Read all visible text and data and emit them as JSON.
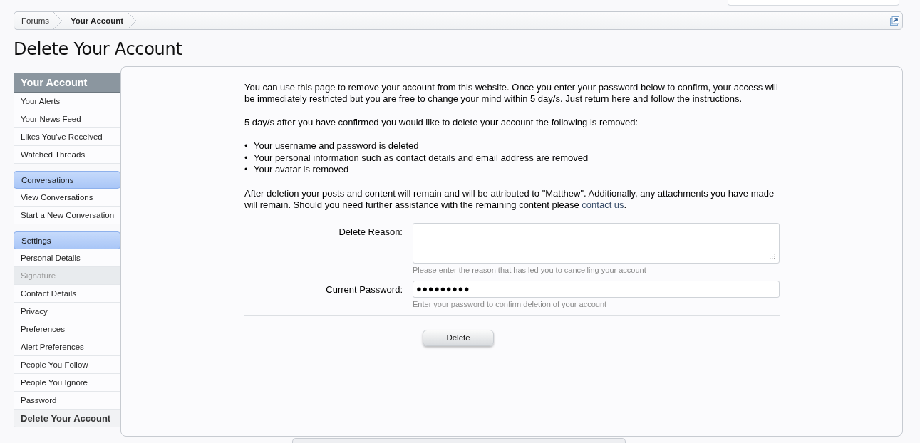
{
  "breadcrumb": [
    {
      "label": "Forums",
      "selected": false
    },
    {
      "label": "Your Account",
      "selected": true
    }
  ],
  "page_title": "Delete Your Account",
  "sidebar": [
    {
      "heading": "Your Account",
      "kind": "main",
      "items": [
        {
          "label": "Your Alerts",
          "selected": false,
          "disabled": false
        },
        {
          "label": "Your News Feed",
          "selected": false,
          "disabled": false
        },
        {
          "label": "Likes You've Received",
          "selected": false,
          "disabled": false
        },
        {
          "label": "Watched Threads",
          "selected": false,
          "disabled": false
        }
      ]
    },
    {
      "heading": "Conversations",
      "kind": "sub",
      "items": [
        {
          "label": "View Conversations",
          "selected": false,
          "disabled": false
        },
        {
          "label": "Start a New Conversation",
          "selected": false,
          "disabled": false
        }
      ]
    },
    {
      "heading": "Settings",
      "kind": "sub",
      "items": [
        {
          "label": "Personal Details",
          "selected": false,
          "disabled": false
        },
        {
          "label": "Signature",
          "selected": false,
          "disabled": true
        },
        {
          "label": "Contact Details",
          "selected": false,
          "disabled": false
        },
        {
          "label": "Privacy",
          "selected": false,
          "disabled": false
        },
        {
          "label": "Preferences",
          "selected": false,
          "disabled": false
        },
        {
          "label": "Alert Preferences",
          "selected": false,
          "disabled": false
        },
        {
          "label": "People You Follow",
          "selected": false,
          "disabled": false
        },
        {
          "label": "People You Ignore",
          "selected": false,
          "disabled": false
        },
        {
          "label": "Password",
          "selected": false,
          "disabled": false
        },
        {
          "label": "Delete Your Account",
          "selected": true,
          "disabled": false
        }
      ]
    }
  ],
  "content": {
    "intro": "You can use this page to remove your account from this website. Once you enter your password below to confirm, your access will be immediately restricted but you are free to change your mind within 5 day/s. Just return here and follow the instructions.",
    "lead": "5 day/s after you have confirmed you would like to delete your account the following is removed:",
    "bullets": [
      {
        "marker": "•",
        "text": "Your username and password is deleted"
      },
      {
        "marker": "•",
        "text": "Your personal information such as contact details and email address are removed"
      },
      {
        "marker": "•",
        "text": "Your avatar is removed"
      }
    ],
    "after": {
      "text": "After deletion your posts and content will remain and will be attributed to \"Matthew\". Additionally, any attachments you have made will remain. Should you need further assistance with the remaining content please ",
      "link": "contact us",
      "tail": "."
    },
    "fields": [
      {
        "kind": "textarea",
        "label": "Delete Reason:",
        "hint": "Please enter the reason that has led you to cancelling your account"
      },
      {
        "kind": "password",
        "label": "Current Password:",
        "value": "●●●●●●●●●",
        "hint": "Enter your password to confirm deletion of your account"
      }
    ],
    "submit": "Delete"
  }
}
